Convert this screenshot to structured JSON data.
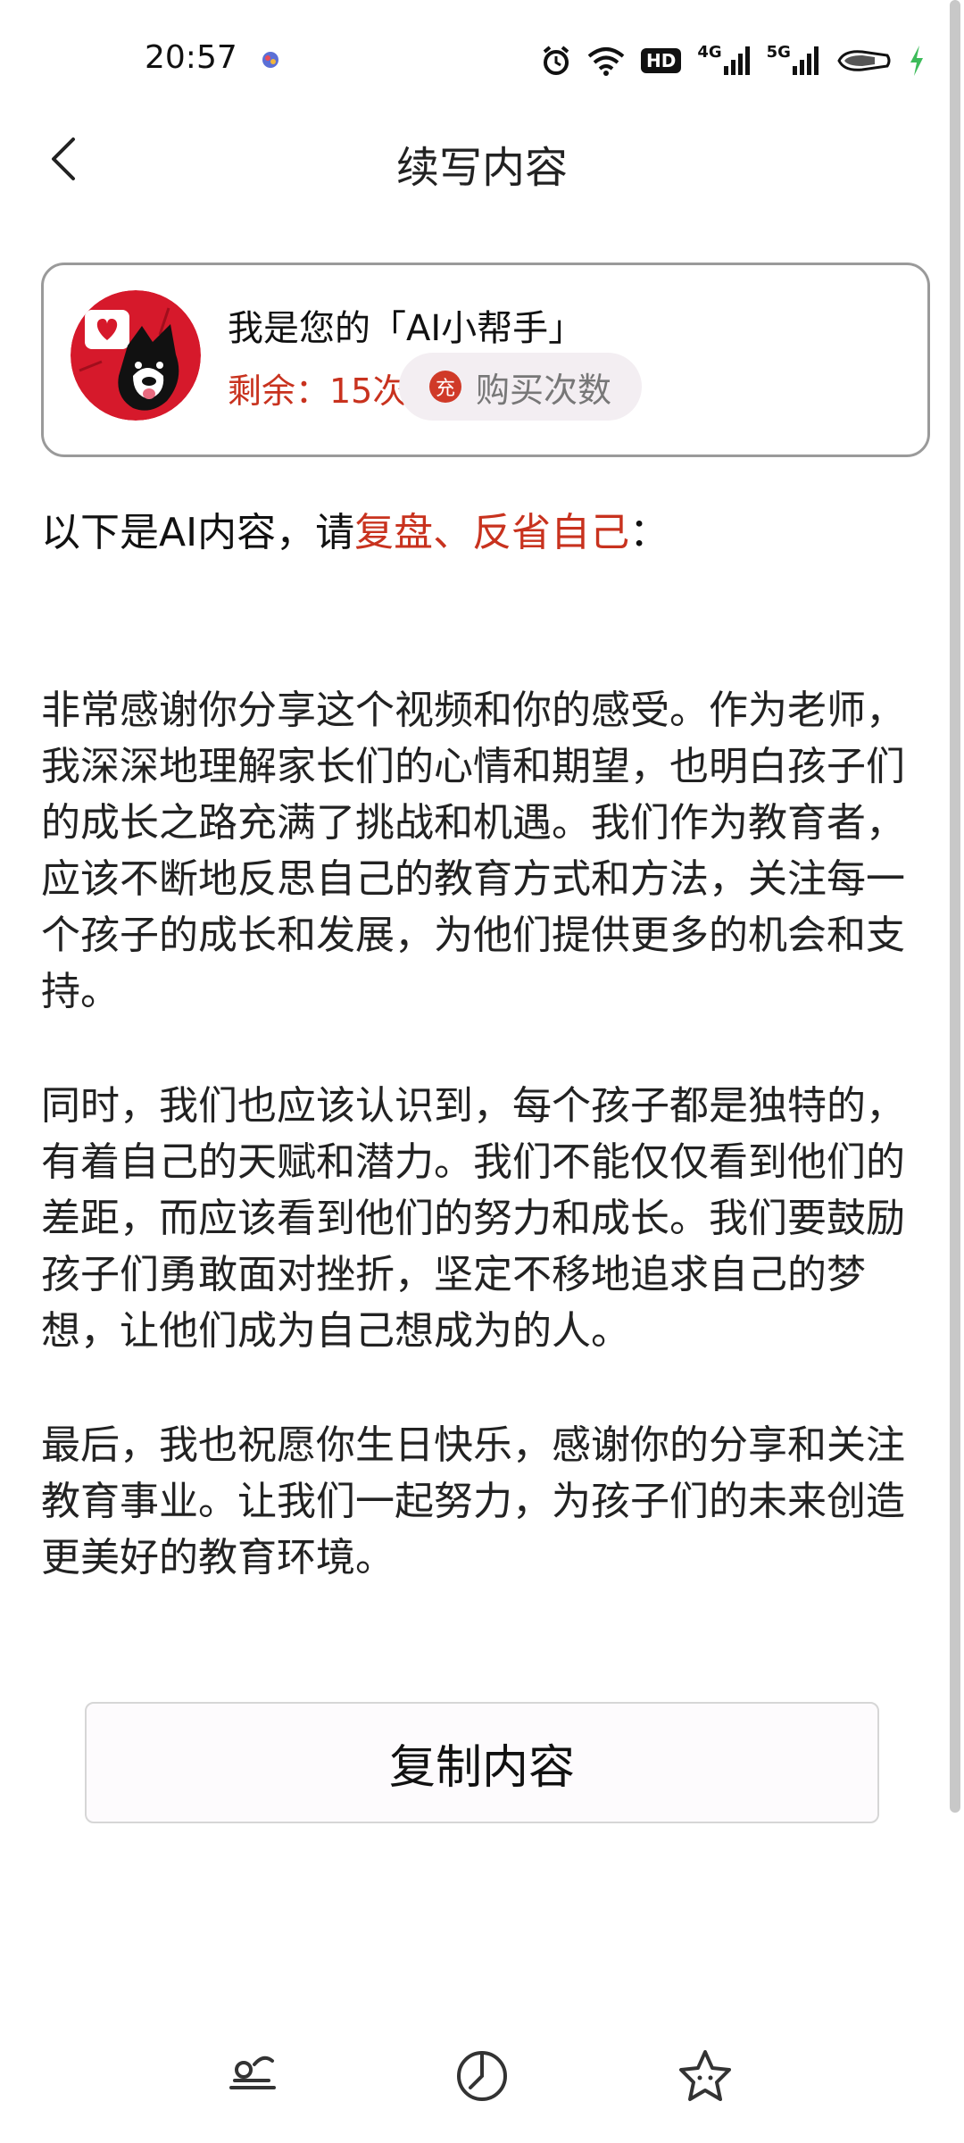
{
  "status_bar": {
    "time": "20:57",
    "icons": [
      "alarm-icon",
      "wifi-icon",
      "hd-icon",
      "signal-4g-icon",
      "signal-5g-icon",
      "battery-icon",
      "charging-icon"
    ],
    "hd_label": "HD",
    "net1": "4G",
    "net2": "5G"
  },
  "header": {
    "title": "续写内容"
  },
  "assistant_card": {
    "title": "我是您的「AI小帮手」",
    "remaining": "剩余：15次",
    "buy_icon_text": "充",
    "buy_label": "购买次数"
  },
  "intro": {
    "prefix": "以下是AI内容，请",
    "accent": "复盘、反省自己",
    "suffix": "："
  },
  "content": {
    "paragraphs": [
      "非常感谢你分享这个视频和你的感受。作为老师，我深深地理解家长们的心情和期望，也明白孩子们的成长之路充满了挑战和机遇。我们作为教育者，应该不断地反思自己的教育方式和方法，关注每一个孩子的成长和发展，为他们提供更多的机会和支持。",
      "同时，我们也应该认识到，每个孩子都是独特的，有着自己的天赋和潜力。我们不能仅仅看到他们的差距，而应该看到他们的努力和成长。我们要鼓励孩子们勇敢面对挫折，坚定不移地追求自己的梦想，让他们成为自己想成为的人。",
      "最后，我也祝愿你生日快乐，感谢你的分享和关注教育事业。让我们一起努力，为孩子们的未来创造更美好的教育环境。"
    ]
  },
  "copy_button": {
    "label": "复制内容"
  },
  "bottom_nav": {
    "items": [
      "nav-tool-icon",
      "nav-compass-icon",
      "nav-star-icon"
    ]
  },
  "colors": {
    "accent": "#c8321e",
    "card_border": "#9a9a9a",
    "buy_bg": "#f3eef2"
  }
}
